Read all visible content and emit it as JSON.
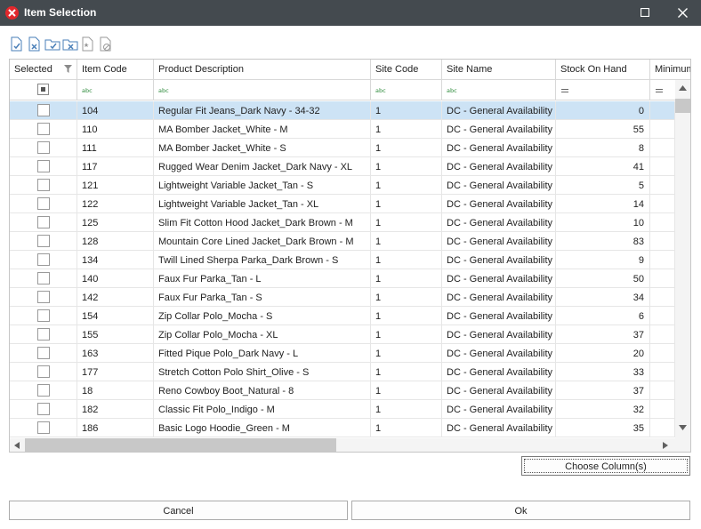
{
  "window": {
    "title": "Item Selection"
  },
  "toolbar": {
    "buttons": [
      "select-all-icon",
      "clear-selection-icon",
      "select-folder-icon",
      "clear-folder-icon",
      "favorite-icon",
      "exclude-icon"
    ]
  },
  "grid": {
    "columns": [
      "Selected",
      "Item Code",
      "Product Description",
      "Site Code",
      "Site Name",
      "Stock On Hand",
      "Minimum"
    ],
    "rows": [
      {
        "code": "104",
        "desc": "Regular Fit Jeans_Dark Navy - 34-32",
        "site_code": "1",
        "site_name": "DC - General Availability",
        "stock": "0"
      },
      {
        "code": "110",
        "desc": "MA Bomber Jacket_White - M",
        "site_code": "1",
        "site_name": "DC - General Availability",
        "stock": "55"
      },
      {
        "code": "111",
        "desc": "MA Bomber Jacket_White - S",
        "site_code": "1",
        "site_name": "DC - General Availability",
        "stock": "8"
      },
      {
        "code": "117",
        "desc": "Rugged Wear Denim Jacket_Dark Navy - XL",
        "site_code": "1",
        "site_name": "DC - General Availability",
        "stock": "41"
      },
      {
        "code": "121",
        "desc": "Lightweight Variable Jacket_Tan - S",
        "site_code": "1",
        "site_name": "DC - General Availability",
        "stock": "5"
      },
      {
        "code": "122",
        "desc": "Lightweight Variable Jacket_Tan - XL",
        "site_code": "1",
        "site_name": "DC - General Availability",
        "stock": "14"
      },
      {
        "code": "125",
        "desc": "Slim Fit Cotton Hood Jacket_Dark Brown - M",
        "site_code": "1",
        "site_name": "DC - General Availability",
        "stock": "10"
      },
      {
        "code": "128",
        "desc": "Mountain Core Lined Jacket_Dark Brown - M",
        "site_code": "1",
        "site_name": "DC - General Availability",
        "stock": "83"
      },
      {
        "code": "134",
        "desc": "Twill Lined Sherpa Parka_Dark Brown - S",
        "site_code": "1",
        "site_name": "DC - General Availability",
        "stock": "9"
      },
      {
        "code": "140",
        "desc": "Faux Fur Parka_Tan - L",
        "site_code": "1",
        "site_name": "DC - General Availability",
        "stock": "50"
      },
      {
        "code": "142",
        "desc": "Faux Fur Parka_Tan - S",
        "site_code": "1",
        "site_name": "DC - General Availability",
        "stock": "34"
      },
      {
        "code": "154",
        "desc": "Zip Collar Polo_Mocha - S",
        "site_code": "1",
        "site_name": "DC - General Availability",
        "stock": "6"
      },
      {
        "code": "155",
        "desc": "Zip Collar Polo_Mocha - XL",
        "site_code": "1",
        "site_name": "DC - General Availability",
        "stock": "37"
      },
      {
        "code": "163",
        "desc": "Fitted Pique Polo_Dark Navy - L",
        "site_code": "1",
        "site_name": "DC - General Availability",
        "stock": "20"
      },
      {
        "code": "177",
        "desc": "Stretch Cotton Polo Shirt_Olive - S",
        "site_code": "1",
        "site_name": "DC - General Availability",
        "stock": "33"
      },
      {
        "code": "18",
        "desc": "Reno Cowboy Boot_Natural - 8",
        "site_code": "1",
        "site_name": "DC - General Availability",
        "stock": "37"
      },
      {
        "code": "182",
        "desc": "Classic Fit Polo_Indigo - M",
        "site_code": "1",
        "site_name": "DC - General Availability",
        "stock": "32"
      },
      {
        "code": "186",
        "desc": "Basic Logo Hoodie_Green - M",
        "site_code": "1",
        "site_name": "DC - General Availability",
        "stock": "35"
      }
    ]
  },
  "buttons": {
    "choose_columns": "Choose Column(s)",
    "cancel": "Cancel",
    "ok": "Ok"
  },
  "colors": {
    "titlebar": "#444a4f",
    "selected_row": "#cde3f5",
    "app_icon": "#e2282c"
  }
}
